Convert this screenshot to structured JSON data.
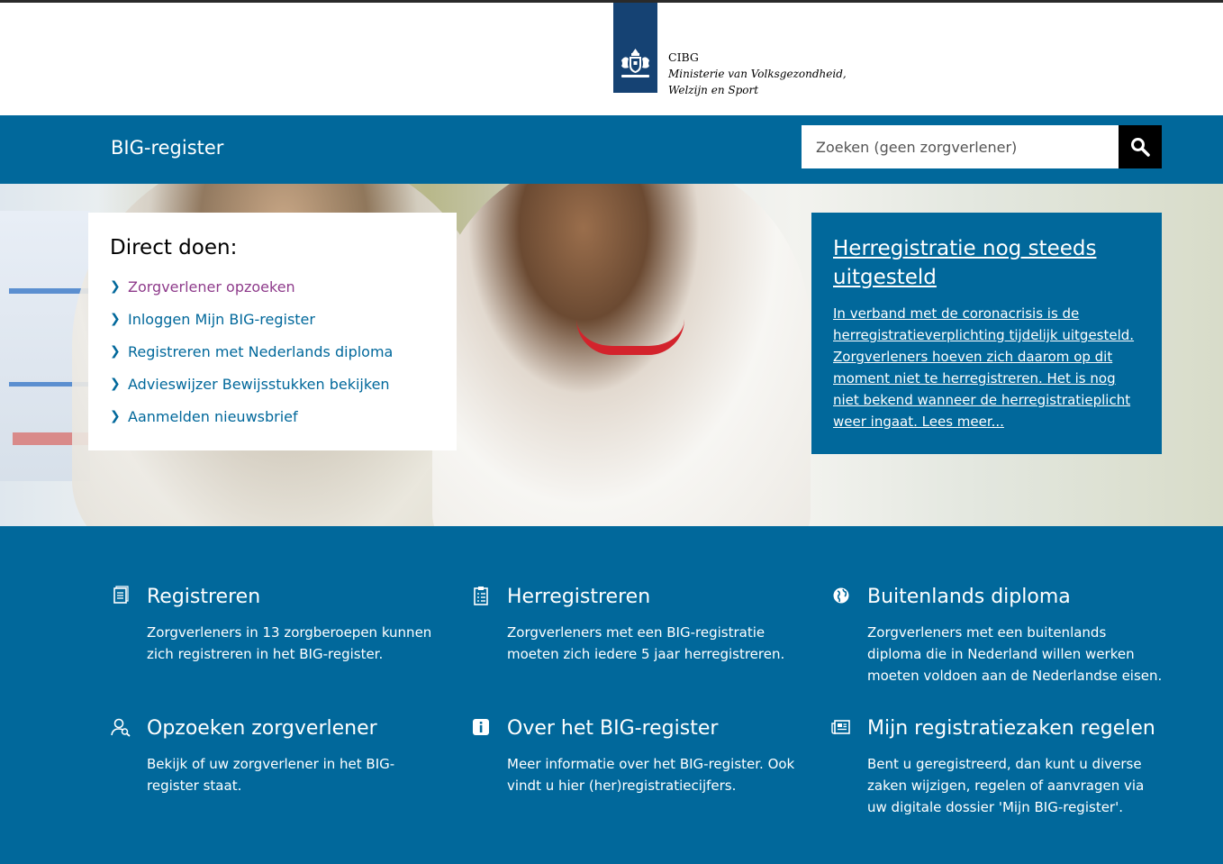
{
  "logo": {
    "org": "CIBG",
    "ministry_line1": "Ministerie van Volksgezondheid,",
    "ministry_line2": "Welzijn en Sport",
    "brand_color": "#154273",
    "icon": "royal-coat-of-arms-icon"
  },
  "header": {
    "site_title": "BIG-register",
    "search_placeholder": "Zoeken (geen zorgverlener)",
    "search_icon": "search-icon",
    "bar_color": "#01689b"
  },
  "direct": {
    "title": "Direct doen:",
    "items": [
      {
        "label": "Zorgverlener opzoeken",
        "visited": true
      },
      {
        "label": "Inloggen Mijn BIG-register",
        "visited": false
      },
      {
        "label": "Registreren met Nederlands diploma",
        "visited": false
      },
      {
        "label": "Advieswijzer Bewijsstukken bekijken",
        "visited": false
      },
      {
        "label": "Aanmelden nieuwsbrief",
        "visited": false
      }
    ]
  },
  "news": {
    "title": "Herregistratie nog steeds uitgesteld",
    "body": "In verband met de coronacrisis is de herregistratieverplichting tijdelijk uitgesteld. Zorgverleners hoeven zich daarom op dit moment niet te herregistreren. Het is nog niet bekend wanneer de herregistratieplicht weer ingaat. Lees meer..."
  },
  "tiles": [
    {
      "icon": "document-icon",
      "title": "Registreren",
      "text": "Zorgverleners in 13 zorgberoepen kunnen zich registreren in het BIG-register."
    },
    {
      "icon": "clipboard-icon",
      "title": "Herregistreren",
      "text": "Zorgverleners met een BIG-registratie moeten zich iedere 5 jaar herregistreren."
    },
    {
      "icon": "globe-icon",
      "title": "Buitenlands diploma",
      "text": "Zorgverleners met een buitenlands diploma die in Nederland willen werken moeten voldoen aan de Nederlandse eisen."
    },
    {
      "icon": "person-search-icon",
      "title": "Opzoeken zorgverlener",
      "text": "Bekijk of uw zorgverlener in het BIG-register staat."
    },
    {
      "icon": "info-icon",
      "title": "Over het BIG-register",
      "text": "Meer informatie over het BIG-register. Ook vindt u hier (her)registratiecijfers."
    },
    {
      "icon": "newspaper-icon",
      "title": "Mijn registratiezaken regelen",
      "text": "Bent u geregistreerd, dan kunt u diverse zaken wijzigen, regelen of aanvragen via uw digitale dossier 'Mijn BIG-register'."
    }
  ]
}
